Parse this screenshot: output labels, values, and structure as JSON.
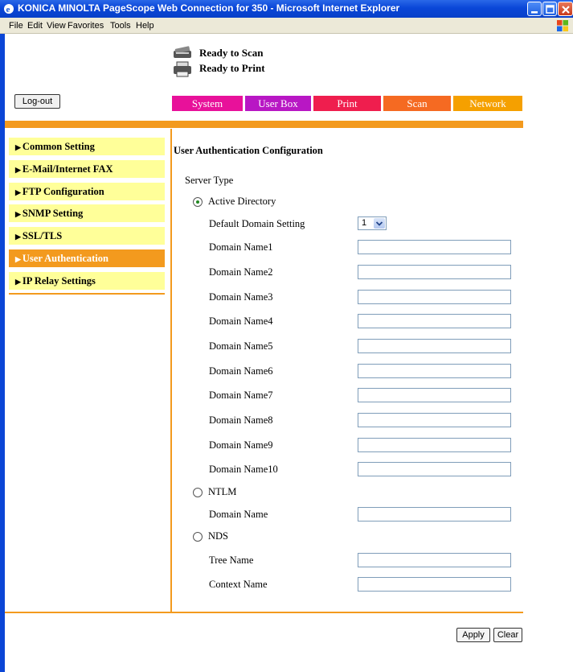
{
  "window": {
    "title": "KONICA MINOLTA PageScope Web Connection for 350 - Microsoft Internet Explorer"
  },
  "menubar": [
    "File",
    "Edit",
    "View",
    "Favorites",
    "Tools",
    "Help"
  ],
  "status": {
    "scan": "Ready to Scan",
    "print": "Ready to Print"
  },
  "logout_label": "Log-out",
  "tabs": [
    {
      "label": "System",
      "color": "#e8119a"
    },
    {
      "label": "User Box",
      "color": "#b817c4"
    },
    {
      "label": "Print",
      "color": "#ef1e4e"
    },
    {
      "label": "Scan",
      "color": "#f56a22"
    },
    {
      "label": "Network",
      "color": "#f5a000"
    }
  ],
  "sidebar": [
    {
      "label": "Common Setting",
      "active": false
    },
    {
      "label": "E-Mail/Internet FAX",
      "active": false
    },
    {
      "label": "FTP Configuration",
      "active": false
    },
    {
      "label": "SNMP Setting",
      "active": false
    },
    {
      "label": "SSL/TLS",
      "active": false
    },
    {
      "label": "User Authentication",
      "active": true
    },
    {
      "label": "IP Relay Settings",
      "active": false
    }
  ],
  "main": {
    "heading": "User Authentication Configuration",
    "server_type_label": "Server Type",
    "active_directory": {
      "label": "Active Directory",
      "selected": true,
      "default_domain_label": "Default Domain Setting",
      "default_domain_value": "1",
      "domains": [
        {
          "label": "Domain Name1",
          "value": ""
        },
        {
          "label": "Domain Name2",
          "value": ""
        },
        {
          "label": "Domain Name3",
          "value": ""
        },
        {
          "label": "Domain Name4",
          "value": ""
        },
        {
          "label": "Domain Name5",
          "value": ""
        },
        {
          "label": "Domain Name6",
          "value": ""
        },
        {
          "label": "Domain Name7",
          "value": ""
        },
        {
          "label": "Domain Name8",
          "value": ""
        },
        {
          "label": "Domain Name9",
          "value": ""
        },
        {
          "label": "Domain Name10",
          "value": ""
        }
      ]
    },
    "ntlm": {
      "label": "NTLM",
      "selected": false,
      "domain_label": "Domain Name",
      "domain_value": ""
    },
    "nds": {
      "label": "NDS",
      "selected": false,
      "tree_label": "Tree Name",
      "tree_value": "",
      "context_label": "Context Name",
      "context_value": ""
    },
    "apply_label": "Apply",
    "clear_label": "Clear"
  }
}
